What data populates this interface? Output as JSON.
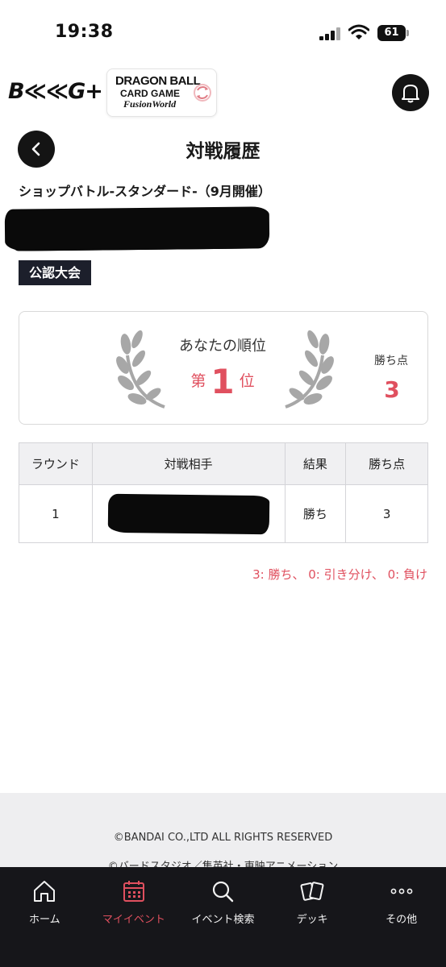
{
  "status_bar": {
    "time": "19:38",
    "battery": "61"
  },
  "header": {
    "brand": "B≪≪G+",
    "game_logo": {
      "line1": "DRAGON BALL",
      "line2": "CARD GAME",
      "line3": "FusionWorld"
    }
  },
  "page": {
    "title": "対戦履歴"
  },
  "event": {
    "name": "ショップバトル-スタンダード-（9月開催）",
    "badge": "公認大会"
  },
  "rank": {
    "label": "あなたの順位",
    "prefix": "第",
    "number": "1",
    "suffix": "位",
    "points_label": "勝ち点",
    "points": "3"
  },
  "table": {
    "headers": [
      "ラウンド",
      "対戦相手",
      "結果",
      "勝ち点"
    ],
    "rows": [
      {
        "round": "1",
        "result": "勝ち",
        "points": "3"
      }
    ]
  },
  "legend": "3: 勝ち、 0: 引き分け、 0: 負け",
  "footer": {
    "copyright": "©BANDAI CO.,LTD ALL RIGHTS RESERVED",
    "copyright2": "©バードスタジオ／集英社・東映アニメーション"
  },
  "nav": {
    "items": [
      {
        "label": "ホーム",
        "icon": "home-icon"
      },
      {
        "label": "マイイベント",
        "icon": "calendar-icon"
      },
      {
        "label": "イベント検索",
        "icon": "search-icon"
      },
      {
        "label": "デッキ",
        "icon": "cards-icon"
      },
      {
        "label": "その他",
        "icon": "more-icon"
      }
    ],
    "active": "マイイベント"
  },
  "colors": {
    "accent": "#e0505f",
    "dark": "#141414",
    "badge": "#1c1f2b",
    "nav_bg": "#16161a"
  }
}
